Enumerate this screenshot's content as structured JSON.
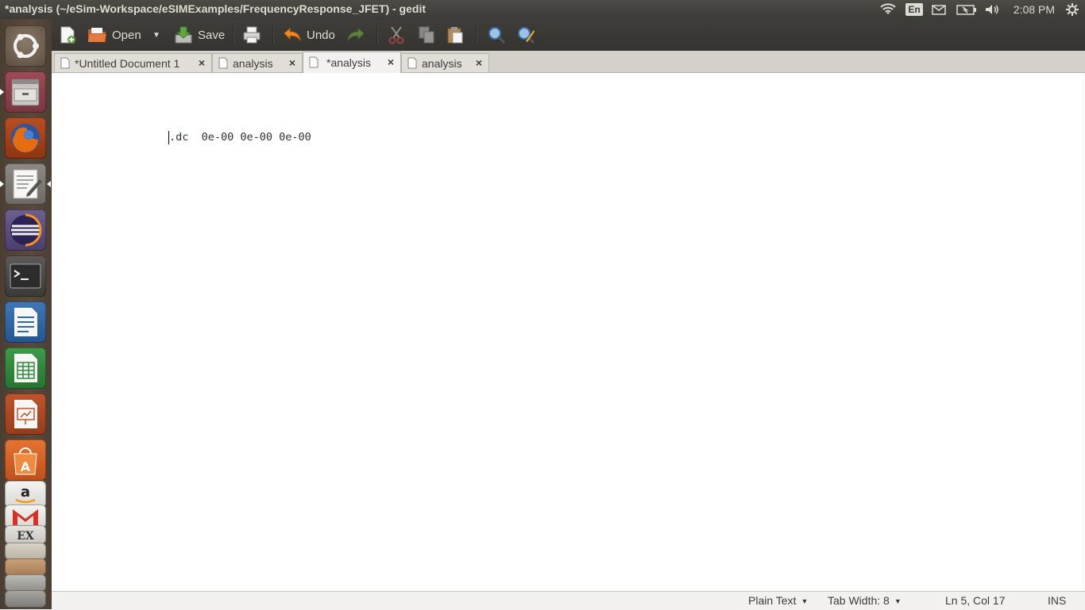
{
  "top_panel": {
    "window_title": "*analysis (~/eSim-Workspace/eSIMExamples/FrequencyResponse_JFET) - gedit",
    "language": "En",
    "clock": "2:08 PM"
  },
  "launcher": {
    "items": [
      {
        "name": "ubuntu-dash-icon"
      },
      {
        "name": "files-icon"
      },
      {
        "name": "firefox-icon"
      },
      {
        "name": "text-editor-icon"
      },
      {
        "name": "eclipse-icon"
      },
      {
        "name": "terminal-icon"
      },
      {
        "name": "libreoffice-writer-icon"
      },
      {
        "name": "libreoffice-calc-icon"
      },
      {
        "name": "libreoffice-impress-icon"
      },
      {
        "name": "software-center-icon"
      },
      {
        "name": "amazon-icon"
      },
      {
        "name": "gmail-icon"
      }
    ]
  },
  "toolbar": {
    "open_label": "Open",
    "save_label": "Save",
    "undo_label": "Undo"
  },
  "tabs": [
    {
      "label": "*Untitled Document 1",
      "active": false
    },
    {
      "label": "analysis",
      "active": false
    },
    {
      "label": "*analysis",
      "active": true
    },
    {
      "label": "analysis",
      "active": false
    }
  ],
  "editor": {
    "content": ".dc  0e-00 0e-00 0e-00"
  },
  "status_bar": {
    "language": "Plain Text",
    "tab_width": "Tab Width: 8",
    "position": "Ln 5, Col 17",
    "mode": "INS"
  },
  "colors": {
    "panel": "#3c3b37",
    "toolbar": "#3e3d39",
    "launcher": "#5a4a3c",
    "editor_bg": "#ffffff"
  }
}
